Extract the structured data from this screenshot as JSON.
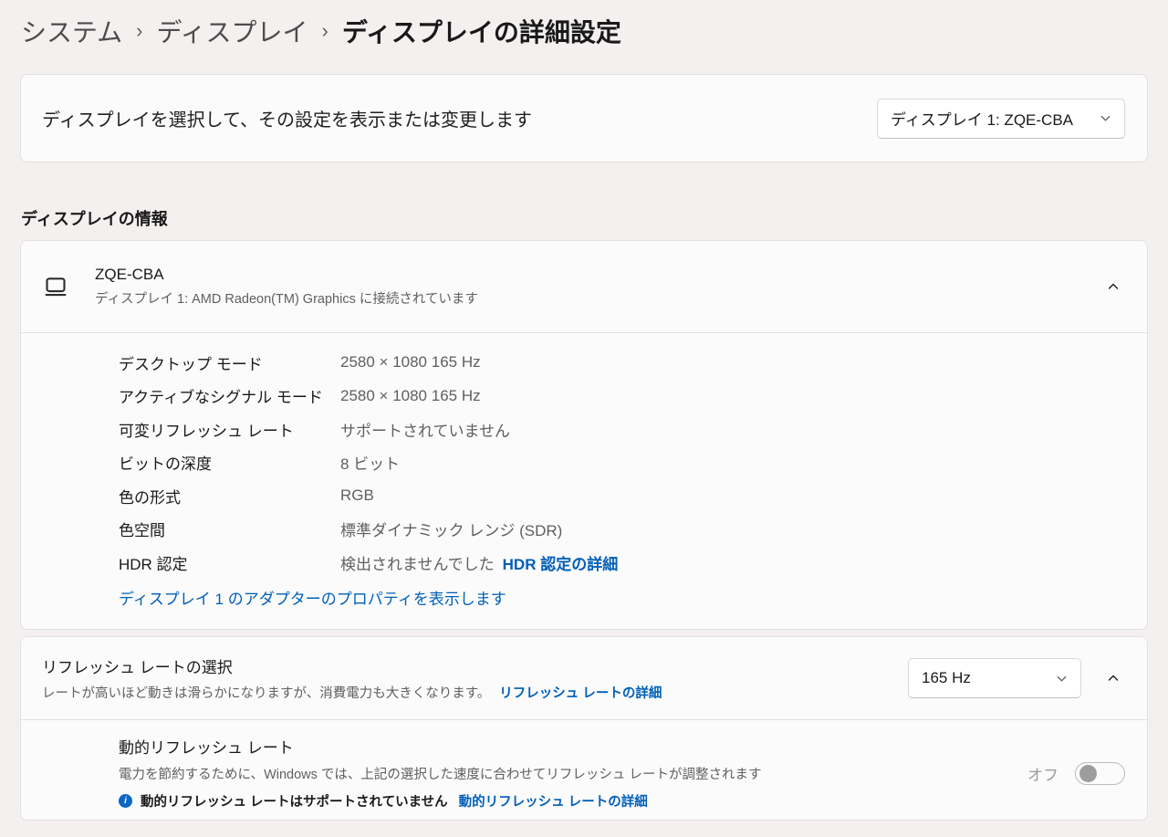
{
  "breadcrumb": {
    "separator": "›",
    "items": [
      {
        "label": "システム"
      },
      {
        "label": "ディスプレイ"
      },
      {
        "label": "ディスプレイの詳細設定"
      }
    ]
  },
  "selector_card": {
    "label": "ディスプレイを選択して、その設定を表示または変更します",
    "dropdown_value": "ディスプレイ 1: ZQE-CBA"
  },
  "display_info": {
    "section_title": "ディスプレイの情報",
    "header": {
      "title": "ZQE-CBA",
      "subtitle": "ディスプレイ 1: AMD Radeon(TM) Graphics に接続されています"
    },
    "rows": [
      {
        "label": "デスクトップ モード",
        "value": "2580 × 1080 165 Hz"
      },
      {
        "label": "アクティブなシグナル モード",
        "value": "2580 × 1080 165 Hz"
      },
      {
        "label": "可変リフレッシュ レート",
        "value": "サポートされていません"
      },
      {
        "label": "ビットの深度",
        "value": "8 ビット"
      },
      {
        "label": "色の形式",
        "value": "RGB"
      },
      {
        "label": "色空間",
        "value": "標準ダイナミック レンジ (SDR)"
      },
      {
        "label": "HDR 認定",
        "value": "検出されませんでした",
        "link": "HDR 認定の詳細"
      }
    ],
    "adapter_link": "ディスプレイ 1 のアダプターのプロパティを表示します"
  },
  "refresh_rate": {
    "title": "リフレッシュ レートの選択",
    "description": "レートが高いほど動きは滑らかになりますが、消費電力も大きくなります。",
    "link": "リフレッシュ レートの詳細",
    "dropdown_value": "165 Hz",
    "dynamic": {
      "title": "動的リフレッシュ レート",
      "description": "電力を節約するために、Windows では、上記の選択した速度に合わせてリフレッシュ レートが調整されます",
      "info_text": "動的リフレッシュ レートはサポートされていません",
      "info_link": "動的リフレッシュ レートの詳細",
      "toggle_label": "オフ",
      "toggle_state": "off"
    }
  },
  "colors": {
    "background": "#f3f0ef",
    "card": "#fbfbfb",
    "link": "#005fb8",
    "info_icon": "#0b67c4",
    "toggle_knob_off": "#9d9d9d"
  }
}
